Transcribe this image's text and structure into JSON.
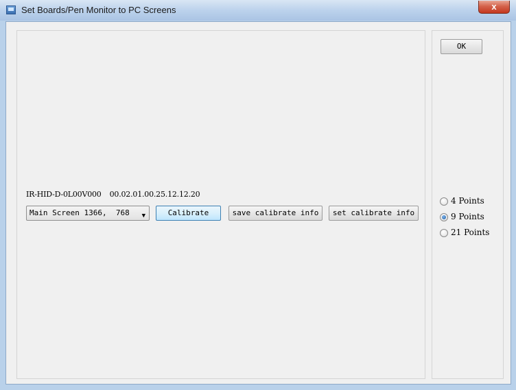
{
  "window": {
    "title": "Set Boards/Pen Monitor to PC Screens",
    "close_label": "x"
  },
  "device": {
    "id": "IR-HID-D-0L00V000",
    "version": "00.02.01.00.25.12.12.20"
  },
  "screen_select": {
    "selected": "Main Screen 1366,  768"
  },
  "buttons": {
    "calibrate": "Calibrate",
    "save_calibrate_info": "save calibrate info",
    "set_calibrate_info": "set calibrate info",
    "ok": "OK"
  },
  "points": {
    "options": [
      {
        "label": "4 Points",
        "checked": false
      },
      {
        "label": "9 Points",
        "checked": true
      },
      {
        "label": "21 Points",
        "checked": false
      }
    ]
  }
}
